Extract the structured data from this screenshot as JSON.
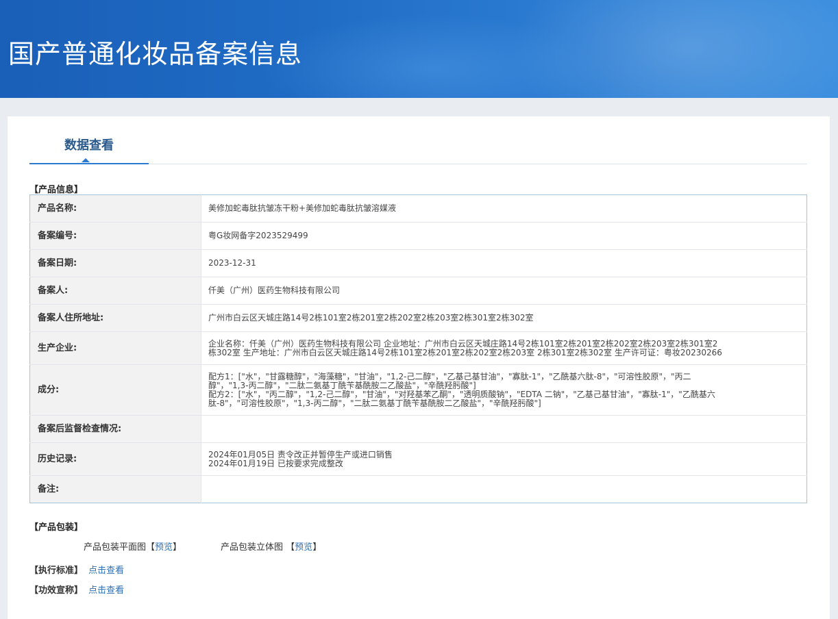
{
  "banner": {
    "title": "国产普通化妆品备案信息"
  },
  "tab": {
    "label": "数据查看"
  },
  "product_info": {
    "section_title": "【产品信息】",
    "rows": [
      {
        "label": "产品名称:",
        "lines": [
          "美修加蛇毒肽抗皱冻干粉+美修加蛇毒肽抗皱溶媒液"
        ]
      },
      {
        "label": "备案编号:",
        "lines": [
          "粤G妆网备字2023529499"
        ]
      },
      {
        "label": "备案日期:",
        "lines": [
          "2023-12-31"
        ]
      },
      {
        "label": "备案人:",
        "lines": [
          "仟美（广州）医药生物科技有限公司"
        ]
      },
      {
        "label": "备案人住所地址:",
        "lines": [
          "广州市白云区天城庄路14号2栋101室2栋201室2栋202室2栋203室2栋301室2栋302室"
        ]
      },
      {
        "label": "生产企业:",
        "lines": [
          "企业名称：仟美（广州）医药生物科技有限公司 企业地址：广州市白云区天城庄路14号2栋101室2栋201室2栋202室2栋203室2栋301室2",
          "栋302室 生产地址：广州市白云区天城庄路14号2栋101室2栋201室2栋202室2栋203室 2栋301室2栋302室 生产许可证：粤妆20230266"
        ]
      },
      {
        "label": "成分:",
        "lines": [
          "配方1：[\"水\"，\"甘露糖醇\"，\"海藻糖\"，\"甘油\"，\"1,2-己二醇\"，\"乙基己基甘油\"，\"寡肽-1\"，\"乙酰基六肽-8\"，\"可溶性胶原\"，\"丙二",
          "醇\"，\"1,3-丙二醇\"，\"二肽二氨基丁酰苄基酰胺二乙酸盐\"，\"辛酰羟肟酸\"]",
          "配方2：[\"水\"，\"丙二醇\"，\"1,2-己二醇\"，\"甘油\"，\"对羟基苯乙酮\"，\"透明质酸钠\"，\"EDTA 二钠\"，\"乙基己基甘油\"，\"寡肽-1\"，\"乙酰基六",
          "肽-8\"，\"可溶性胶原\"，\"1,3-丙二醇\"，\"二肽二氨基丁酰苄基酰胺二乙酸盐\"，\"辛酰羟肟酸\"]"
        ]
      },
      {
        "label": "备案后监督检查情况:",
        "lines": [
          ""
        ]
      },
      {
        "label": "历史记录:",
        "lines": [
          "2024年01月05日 责令改正并暂停生产或进口销售",
          "2024年01月19日 已按要求完成整改"
        ]
      },
      {
        "label": "备注:",
        "lines": [
          ""
        ]
      }
    ]
  },
  "packaging": {
    "section_title": "【产品包装】",
    "flat_label": "产品包装平面图",
    "solid_label": "产品包装立体图",
    "bracket_open": "【",
    "bracket_close": "】",
    "preview_link": "预览"
  },
  "standard": {
    "section_title": "【执行标准】",
    "link": "点击查看"
  },
  "efficacy": {
    "section_title": "【功效宣称】",
    "link": "点击查看"
  }
}
